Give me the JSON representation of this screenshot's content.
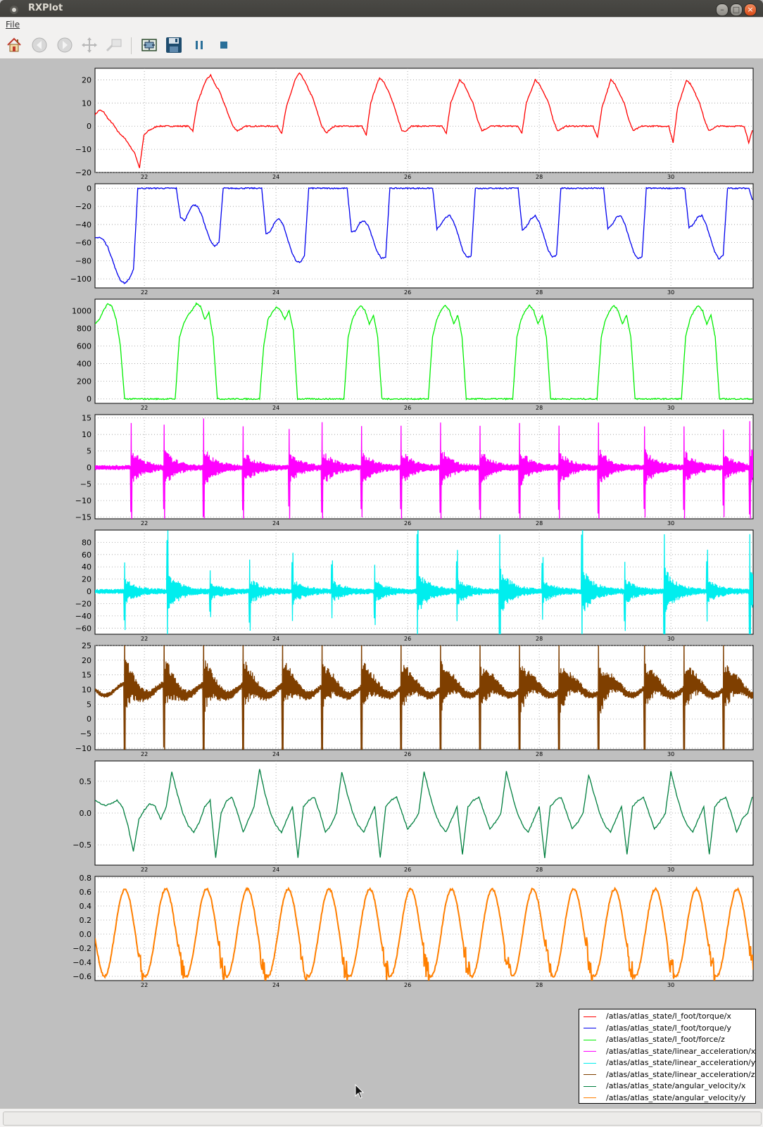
{
  "window": {
    "title": "RXPlot"
  },
  "menubar": {
    "file_label": "File"
  },
  "toolbar": {
    "buttons": [
      {
        "name": "home",
        "icon": "home-icon",
        "enabled": true
      },
      {
        "name": "back",
        "icon": "back-arrow-icon",
        "enabled": false
      },
      {
        "name": "forward",
        "icon": "forward-arrow-icon",
        "enabled": false
      },
      {
        "name": "pan",
        "icon": "pan-cross-icon",
        "enabled": false
      },
      {
        "name": "zoom",
        "icon": "zoom-rect-icon",
        "enabled": false
      },
      {
        "name": "configure",
        "icon": "subplot-config-icon",
        "enabled": true
      },
      {
        "name": "save",
        "icon": "floppy-disk-icon",
        "enabled": true
      },
      {
        "name": "pause",
        "icon": "pause-icon",
        "enabled": true
      },
      {
        "name": "stop",
        "icon": "stop-icon",
        "enabled": true
      }
    ]
  },
  "chart_data": [
    {
      "type": "line",
      "name": "/atlas/atlas_state/l_foot/torque/x",
      "color": "#ff0000",
      "xlim": [
        21.25,
        31.25
      ],
      "xticks": [
        "22",
        "24",
        "26",
        "28",
        "30"
      ],
      "ylim": [
        -20,
        25
      ],
      "yticks": [
        "20",
        "10",
        "0",
        "−10",
        "−20"
      ],
      "y": [
        5,
        7,
        6,
        3,
        1,
        -2,
        -4,
        -6,
        -9,
        -12,
        -18,
        -4,
        -2,
        -1,
        0,
        0,
        0,
        0,
        0,
        0,
        0,
        0,
        -2,
        10,
        15,
        20,
        22,
        18,
        15,
        10,
        5,
        0,
        -2,
        -1,
        0,
        0,
        0,
        0,
        0,
        0,
        0,
        0,
        -3,
        8,
        14,
        20,
        23,
        20,
        16,
        12,
        6,
        0,
        -3,
        -1,
        0,
        0,
        0,
        0,
        0,
        0,
        0,
        -4,
        10,
        16,
        21,
        19,
        15,
        10,
        4,
        -2,
        -2,
        0,
        0,
        0,
        0,
        0,
        0,
        0,
        0,
        -3,
        10,
        15,
        20,
        18,
        14,
        10,
        3,
        -2,
        -1,
        0,
        0,
        0,
        0,
        0,
        0,
        0,
        -3,
        10,
        15,
        20,
        18,
        14,
        10,
        3,
        -2,
        -1,
        0,
        0,
        0,
        0,
        0,
        0,
        0,
        -5,
        8,
        14,
        20,
        18,
        14,
        10,
        3,
        -2,
        -1,
        0,
        0,
        0,
        0,
        0,
        0,
        0,
        -7,
        8,
        14,
        20,
        18,
        14,
        10,
        3,
        -2,
        -1,
        0,
        0,
        0,
        0,
        0,
        0,
        0,
        -7,
        -1
      ]
    },
    {
      "type": "line",
      "name": "/atlas/atlas_state/l_foot/torque/y",
      "color": "#0000ee",
      "xlim": [
        21.25,
        31.25
      ],
      "xticks": [
        "22",
        "24",
        "26",
        "28",
        "30"
      ],
      "ylim": [
        -110,
        5
      ],
      "yticks": [
        "0",
        "−20",
        "−40",
        "−60",
        "−80",
        "−100"
      ],
      "y": [
        -55,
        -54,
        -57,
        -65,
        -78,
        -92,
        -102,
        -105,
        -100,
        -90,
        0,
        0,
        0,
        0,
        0,
        0,
        0,
        0,
        0,
        0,
        -32,
        -36,
        -25,
        -18,
        -20,
        -30,
        -45,
        -58,
        -64,
        -60,
        0,
        0,
        0,
        0,
        0,
        0,
        0,
        0,
        0,
        0,
        -50,
        -48,
        -38,
        -33,
        -40,
        -55,
        -70,
        -80,
        -82,
        -75,
        0,
        0,
        0,
        0,
        0,
        0,
        0,
        0,
        0,
        0,
        -48,
        -47,
        -38,
        -36,
        -42,
        -56,
        -70,
        -77,
        -76,
        0,
        0,
        0,
        0,
        0,
        0,
        0,
        0,
        0,
        0,
        0,
        -45,
        -40,
        -32,
        -30,
        -38,
        -52,
        -68,
        -76,
        -75,
        0,
        0,
        0,
        0,
        0,
        0,
        0,
        0,
        0,
        0,
        0,
        -46,
        -42,
        -34,
        -30,
        -38,
        -52,
        -68,
        -76,
        -74,
        0,
        0,
        0,
        0,
        0,
        0,
        0,
        0,
        0,
        0,
        0,
        -45,
        -40,
        -32,
        -30,
        -40,
        -55,
        -70,
        -78,
        -76,
        0,
        0,
        0,
        0,
        0,
        0,
        0,
        0,
        0,
        0,
        -44,
        -40,
        -32,
        -30,
        -40,
        -55,
        -70,
        -78,
        -74,
        0,
        0,
        0,
        0,
        0,
        0,
        -15
      ]
    },
    {
      "type": "line",
      "name": "/atlas/atlas_state/l_foot/force/z",
      "color": "#00ee00",
      "xlim": [
        21.25,
        31.25
      ],
      "xticks": [
        "22",
        "24",
        "26",
        "28",
        "30"
      ],
      "ylim": [
        -50,
        1130
      ],
      "yticks": [
        "1000",
        "800",
        "600",
        "400",
        "200",
        "0"
      ],
      "y": [
        850,
        900,
        1000,
        1080,
        1050,
        900,
        600,
        0,
        0,
        0,
        0,
        0,
        0,
        0,
        0,
        0,
        0,
        0,
        0,
        0,
        700,
        850,
        950,
        1000,
        1080,
        1050,
        900,
        980,
        700,
        0,
        0,
        0,
        0,
        0,
        0,
        0,
        0,
        0,
        0,
        0,
        600,
        900,
        980,
        1040,
        1000,
        900,
        1000,
        780,
        0,
        0,
        0,
        0,
        0,
        0,
        0,
        0,
        0,
        0,
        0,
        0,
        700,
        900,
        1000,
        1060,
        1000,
        850,
        950,
        700,
        0,
        0,
        0,
        0,
        0,
        0,
        0,
        0,
        0,
        0,
        0,
        0,
        700,
        900,
        1000,
        1060,
        1000,
        850,
        950,
        700,
        0,
        0,
        0,
        0,
        0,
        0,
        0,
        0,
        0,
        0,
        0,
        0,
        700,
        900,
        1000,
        1060,
        1000,
        850,
        950,
        700,
        0,
        0,
        0,
        0,
        0,
        0,
        0,
        0,
        0,
        0,
        0,
        0,
        700,
        900,
        1000,
        1060,
        1000,
        850,
        950,
        700,
        0,
        0,
        0,
        0,
        0,
        0,
        0,
        0,
        0,
        0,
        0,
        0,
        700,
        900,
        1000,
        1060,
        1000,
        850,
        950,
        700,
        0,
        0,
        0,
        0,
        0,
        0,
        0,
        0,
        0
      ]
    },
    {
      "type": "line",
      "name": "/atlas/atlas_state/linear_acceleration/x",
      "color": "#ff00ff",
      "xlim": [
        21.25,
        31.25
      ],
      "xticks": [
        "22",
        "24",
        "26",
        "28",
        "30"
      ],
      "ylim": [
        -15.5,
        16
      ],
      "yticks": [
        "15",
        "10",
        "5",
        "0",
        "−5",
        "−10",
        "−15"
      ],
      "spikes_at": [
        21.8,
        22.3,
        22.9,
        23.5,
        24.2,
        24.7,
        25.3,
        25.9,
        26.5,
        27.1,
        27.7,
        28.3,
        28.9,
        29.6,
        30.2,
        30.8,
        31.2
      ],
      "spike_amp": [
        13,
        12,
        14,
        12,
        11,
        13,
        12,
        12,
        13,
        12,
        13,
        12,
        13,
        12,
        12,
        11,
        13
      ]
    },
    {
      "type": "line",
      "name": "/atlas/atlas_state/linear_acceleration/y",
      "color": "#00eeee",
      "xlim": [
        21.25,
        31.25
      ],
      "xticks": [
        "22",
        "24",
        "26",
        "28",
        "30"
      ],
      "ylim": [
        -70,
        100
      ],
      "yticks": [
        "80",
        "60",
        "40",
        "20",
        "0",
        "−20",
        "−40",
        "−60"
      ],
      "spikes_at": [
        21.7,
        22.35,
        23.0,
        23.6,
        24.25,
        24.85,
        25.5,
        26.15,
        26.75,
        27.4,
        28.05,
        28.65,
        29.3,
        29.9,
        30.55,
        31.2
      ],
      "spike_amp": [
        45,
        80,
        30,
        48,
        45,
        40,
        40,
        90,
        45,
        90,
        42,
        90,
        45,
        90,
        46,
        90
      ]
    },
    {
      "type": "line",
      "name": "/atlas/atlas_state/linear_acceleration/z",
      "color": "#7f3f00",
      "xlim": [
        21.25,
        31.25
      ],
      "xticks": [
        "22",
        "24",
        "26",
        "28",
        "30"
      ],
      "ylim": [
        -10.5,
        25
      ],
      "yticks": [
        "25",
        "20",
        "15",
        "10",
        "5",
        "0",
        "−5",
        "−10"
      ],
      "spikes_at": [
        21.7,
        22.3,
        22.9,
        23.5,
        24.1,
        24.7,
        25.3,
        25.9,
        26.5,
        27.1,
        27.7,
        28.3,
        28.9,
        29.6,
        30.2,
        30.8
      ],
      "spike_amp": [
        22,
        21,
        23,
        21,
        21,
        21,
        21,
        21,
        21,
        21,
        21,
        21,
        21,
        21,
        21,
        21
      ]
    },
    {
      "type": "line",
      "name": "/atlas/atlas_state/angular_velocity/x",
      "color": "#007f3f",
      "xlim": [
        21.25,
        31.25
      ],
      "xticks": [
        "22",
        "24",
        "26",
        "28",
        "30"
      ],
      "ylim": [
        -0.82,
        0.82
      ],
      "yticks": [
        "0.5",
        "0.0",
        "−0.5"
      ],
      "y": [
        0.2,
        0.15,
        0.12,
        0.15,
        0.2,
        0.1,
        -0.2,
        -0.6,
        -0.1,
        0.05,
        0.15,
        0.1,
        -0.1,
        0.1,
        0.65,
        0.3,
        0.0,
        -0.2,
        -0.3,
        -0.15,
        0.1,
        0.2,
        -0.7,
        0.0,
        0.2,
        0.25,
        0.0,
        -0.3,
        -0.1,
        0.1,
        0.7,
        0.3,
        0.0,
        -0.2,
        -0.3,
        -0.1,
        0.1,
        -0.7,
        0.1,
        0.2,
        0.25,
        0.0,
        -0.3,
        -0.2,
        0.0,
        0.65,
        0.3,
        0.0,
        -0.2,
        -0.3,
        -0.1,
        0.1,
        -0.7,
        0.1,
        0.2,
        0.25,
        0.0,
        -0.25,
        -0.15,
        0.0,
        0.65,
        0.3,
        0.0,
        -0.2,
        -0.3,
        -0.1,
        0.1,
        -0.65,
        0.1,
        0.2,
        0.25,
        0.0,
        -0.25,
        -0.15,
        0.0,
        0.65,
        0.3,
        0.0,
        -0.2,
        -0.3,
        -0.1,
        0.1,
        -0.7,
        0.1,
        0.2,
        0.25,
        0.0,
        -0.25,
        -0.15,
        0.0,
        0.6,
        0.3,
        0.0,
        -0.2,
        -0.3,
        -0.1,
        0.1,
        -0.65,
        0.1,
        0.2,
        0.25,
        0.0,
        -0.25,
        -0.15,
        0.0,
        0.65,
        0.3,
        0.0,
        -0.2,
        -0.3,
        -0.1,
        0.1,
        -0.65,
        0.1,
        0.2,
        0.25,
        0.0,
        -0.3,
        -0.1,
        0.0,
        0.3
      ]
    },
    {
      "type": "line",
      "name": "/atlas/atlas_state/angular_velocity/y",
      "color": "#ff7f00",
      "xlim": [
        21.25,
        31.25
      ],
      "xticks": [
        "22",
        "24",
        "26",
        "28",
        "30"
      ],
      "ylim": [
        -0.66,
        0.82
      ],
      "yticks": [
        "0.8",
        "0.6",
        "0.4",
        "0.2",
        "0.0",
        "−0.2",
        "−0.4",
        "−0.6"
      ],
      "period": 0.62,
      "phase": 21.55,
      "amp": 0.62,
      "offset": 0.02
    }
  ],
  "legend": {
    "entries": [
      {
        "label": "/atlas/atlas_state/l_foot/torque/x",
        "color": "#ff0000"
      },
      {
        "label": "/atlas/atlas_state/l_foot/torque/y",
        "color": "#0000ee"
      },
      {
        "label": "/atlas/atlas_state/l_foot/force/z",
        "color": "#00ee00"
      },
      {
        "label": "/atlas/atlas_state/linear_acceleration/x",
        "color": "#ff00ff"
      },
      {
        "label": "/atlas/atlas_state/linear_acceleration/y",
        "color": "#00eeee"
      },
      {
        "label": "/atlas/atlas_state/linear_acceleration/z",
        "color": "#7f3f00"
      },
      {
        "label": "/atlas/atlas_state/angular_velocity/x",
        "color": "#007f3f"
      },
      {
        "label": "/atlas/atlas_state/angular_velocity/y",
        "color": "#ff7f00"
      }
    ]
  },
  "statusbar": {
    "text": ""
  }
}
